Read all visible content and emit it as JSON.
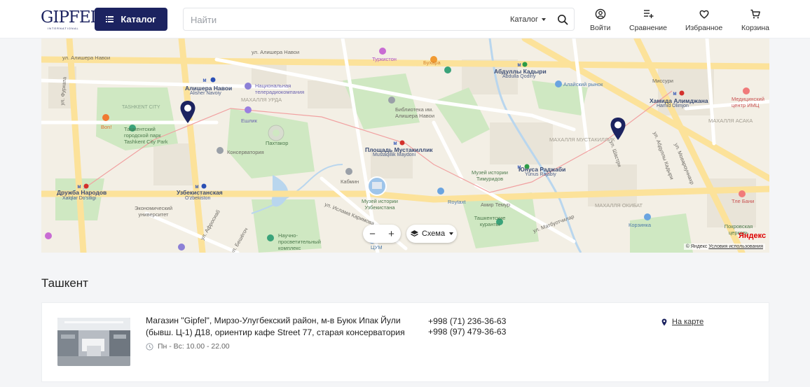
{
  "header": {
    "logo_text": "GIPFEL",
    "logo_sub": "INTERNATIONAL",
    "catalog_label": "Каталог",
    "search_placeholder": "Найти",
    "search_scope": "Каталог",
    "nav": [
      {
        "label": "Войти",
        "icon": "user-icon"
      },
      {
        "label": "Сравнение",
        "icon": "compare-icon"
      },
      {
        "label": "Избранное",
        "icon": "heart-icon"
      },
      {
        "label": "Корзина",
        "icon": "cart-icon"
      }
    ],
    "accent_color": "#1c2360"
  },
  "map": {
    "labels": [
      "ул. Алишера Навои",
      "Алишера Навои",
      "Alisher Navoiy",
      "Национальная телерадиокомпания",
      "Туркистон",
      "Бухара",
      "Абдуллы Кадыри",
      "Abdulla Qodiriy",
      "Алайский рынок",
      "Миссури",
      "Хамида Алимджана",
      "Hamid Olimjon",
      "Медицинский центр ИМЦ",
      "TASHKENT CITY",
      "Ташкентский городской парк",
      "Tashkent City Park",
      "Bon!",
      "Пахтакор",
      "Консерватория",
      "Площадь Мустакиллик",
      "Mustaqillik Maydoni",
      "Библиотека им. Алишера Навои",
      "Кабмин",
      "Музей истории Узбекистана",
      "Музей истории Тимуридов",
      "Юнуса Раджаби",
      "Yunus Rajabiy",
      "Дружба Народов",
      "Xalqlar Do'stligi",
      "Узбекистанская",
      "O'zbekiston",
      "Экономический университет",
      "Амир Темур",
      "Ташкентские куранты",
      "Корзинка",
      "Покровская церковь",
      "Тле Бани",
      "Научно-просветительный комплекс",
      "ЦУМ",
      "ул. Фурката",
      "ул. Шастри",
      "ул. Абдуллы Кадыри",
      "ул. Мовароуннахр",
      "ул. Матбуотчилар",
      "МАХАЛЛЯ УРДА",
      "МАХАЛЛЯ МУСТАКИЛЛИК",
      "МАХАЛЛЯ АСАКА",
      "Roytaxt",
      "ул. Ислама Каримова",
      "ул. Бешёгоч",
      "ул. Афросиаб",
      "МАХАЛЛЯ ОКИБАТ",
      "Ешлик"
    ],
    "zoom_out": "−",
    "zoom_in": "+",
    "scheme_label": "Схема",
    "copyright": "© Яндекс",
    "terms": "Условия использования",
    "provider_logo": "Яндекс"
  },
  "city": "Ташкент",
  "store": {
    "address": "Магазин \"Gipfel\", Мирзо-Улугбекский район, м-в Буюк Ипак Йули (бывш. Ц-1) Д18, ориентир кафе Street 77, старая консерватория",
    "hours": "Пн - Вс: 10.00 - 22.00",
    "phones": [
      "+998 (71) 236-36-63",
      "+998 (97) 479-36-63"
    ],
    "on_map": "На карте"
  }
}
